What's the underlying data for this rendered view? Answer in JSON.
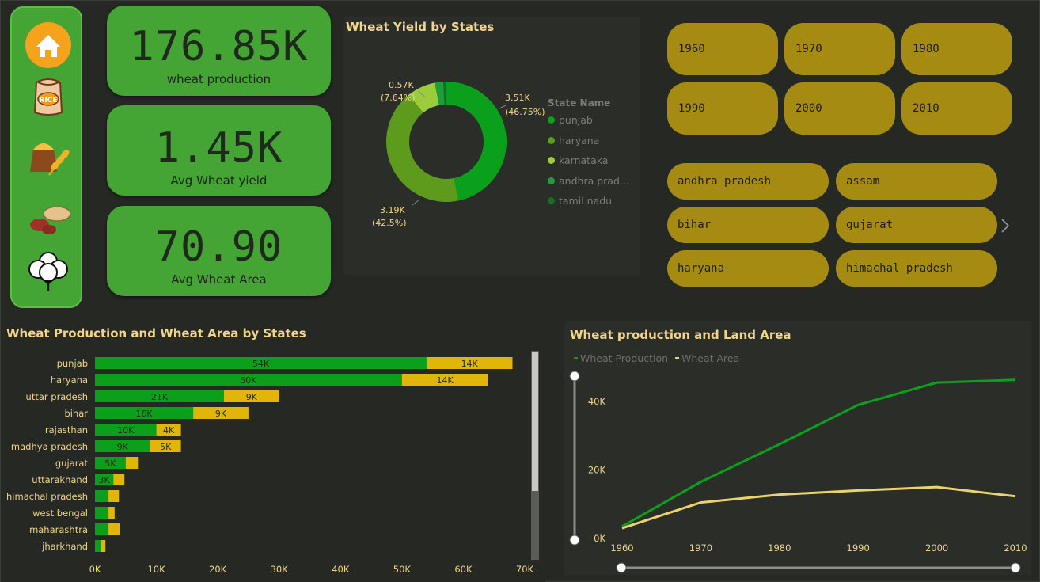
{
  "nav": {
    "items": [
      {
        "name": "home",
        "icon": "home-icon"
      },
      {
        "name": "rice",
        "icon": "rice-bag-icon",
        "label": "RICE"
      },
      {
        "name": "wheat",
        "icon": "wheat-flour-icon"
      },
      {
        "name": "groundnut",
        "icon": "peanut-icon"
      },
      {
        "name": "cotton",
        "icon": "cotton-icon"
      }
    ]
  },
  "kpis": [
    {
      "value": "176.85K",
      "label": "wheat production"
    },
    {
      "value": "1.45K",
      "label": "Avg Wheat yield"
    },
    {
      "value": "70.90",
      "label": "Avg Wheat Area"
    }
  ],
  "donut": {
    "title": "Wheat Yield by States",
    "legend_title": "State Name",
    "legend": [
      {
        "name": "punjab",
        "color": "#0aa01b"
      },
      {
        "name": "haryana",
        "color": "#5c9b1c"
      },
      {
        "name": "karnataka",
        "color": "#9ccc3c"
      },
      {
        "name": "andhra prad...",
        "color": "#1e9e3a"
      },
      {
        "name": "tamil nadu",
        "color": "#146e24"
      }
    ],
    "labels": {
      "punjab_value": "3.51K",
      "punjab_pct": "(46.75%)",
      "haryana_value": "3.19K",
      "haryana_pct": "(42.5%)",
      "karnataka_value": "0.57K",
      "karnataka_pct": "(7.64%)"
    }
  },
  "years": [
    "1960",
    "1970",
    "1980",
    "1990",
    "2000",
    "2010"
  ],
  "states": [
    "andhra pradesh",
    "assam",
    "bihar",
    "gujarat",
    "haryana",
    "himachal pradesh"
  ],
  "chart_data": [
    {
      "type": "bar",
      "title": "Wheat Production and Wheat Area by States",
      "orientation": "horizontal",
      "stacked": true,
      "categories": [
        "punjab",
        "haryana",
        "uttar pradesh",
        "bihar",
        "rajasthan",
        "madhya pradesh",
        "gujarat",
        "uttarakhand",
        "himachal pradesh",
        "west bengal",
        "maharashtra",
        "jharkhand"
      ],
      "series": [
        {
          "name": "Wheat Production",
          "color": "#0aa01b",
          "values": [
            54000,
            50000,
            21000,
            16000,
            10000,
            9000,
            5000,
            3000,
            2200,
            2200,
            2200,
            1000
          ],
          "labels": [
            "54K",
            "50K",
            "21K",
            "16K",
            "10K",
            "9K",
            "5K",
            "3K",
            "",
            "",
            "",
            ""
          ]
        },
        {
          "name": "Wheat Area",
          "color": "#e0b60b",
          "values": [
            14000,
            14000,
            9000,
            9000,
            4000,
            5000,
            2000,
            1800,
            1700,
            1000,
            1800,
            700
          ],
          "labels": [
            "14K",
            "14K",
            "9K",
            "9K",
            "4K",
            "5K",
            "",
            "",
            "",
            "",
            "",
            ""
          ]
        }
      ],
      "xaxis": {
        "ticks": [
          "0K",
          "10K",
          "20K",
          "30K",
          "40K",
          "50K",
          "60K",
          "70K"
        ],
        "max": 70000
      }
    },
    {
      "type": "line",
      "title": "Wheat production and Land Area",
      "x": [
        1960,
        1970,
        1980,
        1990,
        2000,
        2010
      ],
      "xticks": [
        "1960",
        "1970",
        "1980",
        "1990",
        "2000",
        "2010"
      ],
      "yticks": [
        "0K",
        "20K",
        "40K"
      ],
      "ylim": [
        0,
        52000
      ],
      "legend": "top-left",
      "series": [
        {
          "name": "Wheat Production",
          "color": "#0aa01b",
          "values": [
            3500,
            16500,
            27500,
            39000,
            45500,
            46300
          ]
        },
        {
          "name": "Wheat Area",
          "color": "#ead36a",
          "values": [
            3000,
            10500,
            12800,
            14000,
            15000,
            12300
          ]
        }
      ]
    }
  ]
}
